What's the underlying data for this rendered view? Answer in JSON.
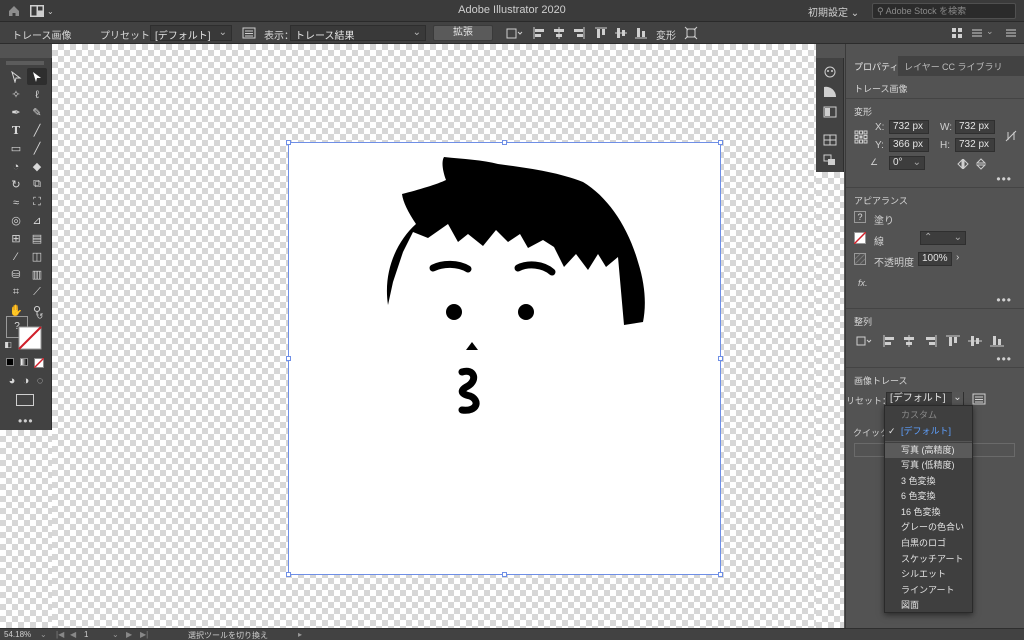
{
  "window": {
    "title": "Adobe Illustrator 2020",
    "workspace": "初期設定",
    "search_placeholder": "Adobe Stock を検索"
  },
  "controlbar": {
    "context_label": "トレース画像",
    "preset_label": "プリセット：",
    "preset_value": "[デフォルト]",
    "view_label": "表示：",
    "view_value": "トレース結果",
    "expand_button": "拡張",
    "transform_label": "変形"
  },
  "panel": {
    "tabs": [
      "プロパティ",
      "レイヤー",
      "CC ライブラリ"
    ],
    "object_type": "トレース画像",
    "transform": {
      "title": "変形",
      "x_label": "X:",
      "x_value": "732 px",
      "y_label": "Y:",
      "y_value": "366 px",
      "w_label": "W:",
      "w_value": "732 px",
      "h_label": "H:",
      "h_value": "732 px",
      "angle_value": "0°"
    },
    "appearance": {
      "title": "アピアランス",
      "fill_label": "塗り",
      "stroke_label": "線",
      "opacity_label": "不透明度",
      "opacity_value": "100%",
      "fx_label": "fx."
    },
    "align": {
      "title": "整列"
    },
    "image_trace": {
      "title": "画像トレース",
      "preset_label": "リセット：",
      "preset_value": "[デフォルト]",
      "quick_label": "クイック"
    }
  },
  "preset_menu": {
    "items": [
      {
        "label": "カスタム",
        "state": "disabled"
      },
      {
        "label": "[デフォルト]",
        "state": "checked"
      },
      {
        "label": "写真 (高精度)",
        "state": "hover"
      },
      {
        "label": "写真 (低精度)",
        "state": "normal"
      },
      {
        "label": "3 色変換",
        "state": "normal"
      },
      {
        "label": "6 色変換",
        "state": "normal"
      },
      {
        "label": "16 色変換",
        "state": "normal"
      },
      {
        "label": "グレーの色合い",
        "state": "normal"
      },
      {
        "label": "白黒のロゴ",
        "state": "normal"
      },
      {
        "label": "スケッチアート",
        "state": "normal"
      },
      {
        "label": "シルエット",
        "state": "normal"
      },
      {
        "label": "ラインアート",
        "state": "normal"
      },
      {
        "label": "図面",
        "state": "normal"
      }
    ]
  },
  "statusbar": {
    "zoom": "54.18%",
    "artboard_number": "1",
    "tool_hint": "選択ツールを切り換え"
  },
  "colors": {
    "selection": "#6f8fe6",
    "checked_item": "#5ea0ff",
    "stroke_red": "#d0202a"
  }
}
